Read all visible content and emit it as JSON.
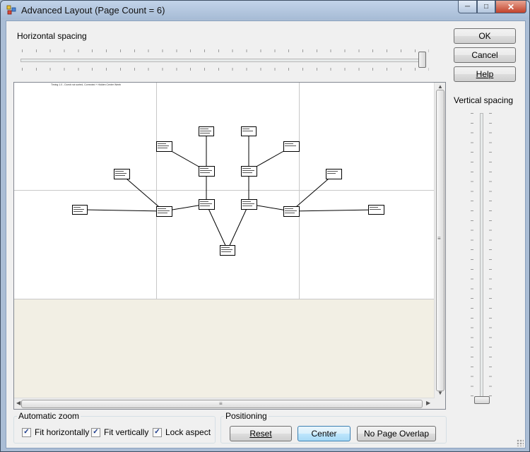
{
  "window": {
    "title": "Advanced Layout (Page Count = 6)",
    "minimize_glyph": "─",
    "maximize_glyph": "□",
    "close_glyph": "✕"
  },
  "horizontal_spacing": {
    "label": "Horizontal spacing",
    "value_fraction": 1.0
  },
  "vertical_spacing": {
    "label": "Vertical spacing",
    "value_fraction": 0.0
  },
  "buttons": {
    "ok": "OK",
    "cancel": "Cancel",
    "help": "Help"
  },
  "preview": {
    "header_text": "Timing 1.0 - Dumb not sorted, Corrected + Hidden Center Weeb",
    "scroll_grip": "≡",
    "arrow_up": "▲",
    "arrow_down": "▼",
    "arrow_left": "◀",
    "arrow_right": "▶"
  },
  "automatic_zoom": {
    "legend": "Automatic zoom",
    "options": [
      {
        "label": "Fit horizontally",
        "checked": true,
        "mark": "✓"
      },
      {
        "label": "Fit vertically",
        "checked": true,
        "mark": "✓"
      },
      {
        "label": "Lock aspect",
        "checked": true,
        "mark": "✓"
      }
    ]
  },
  "positioning": {
    "legend": "Positioning",
    "reset": "Reset",
    "center": "Center",
    "no_page_overlap": "No Page Overlap"
  }
}
